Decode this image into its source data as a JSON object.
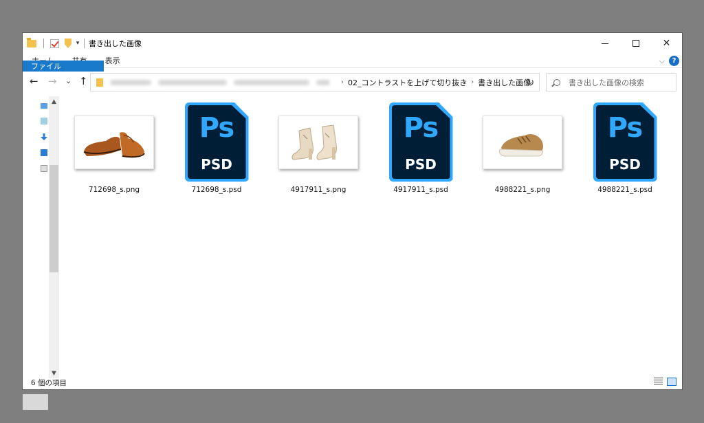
{
  "titlebar": {
    "title": "書き出した画像",
    "quick_access_dropdown": "▾"
  },
  "window_controls": {
    "close": "✕"
  },
  "ribbon": {
    "tabs": [
      "ファイル",
      "ホーム",
      "共有",
      "表示"
    ],
    "collapse_glyph": "⌵",
    "help_glyph": "?"
  },
  "nav": {
    "back": "←",
    "forward": "→",
    "recent": "⌄",
    "up": "↑"
  },
  "address": {
    "crumbs": [
      "02_コントラストを上げて切り抜き",
      "書き出した画像"
    ],
    "separator": "›",
    "dropdown": "⌄",
    "refresh": "↻"
  },
  "search": {
    "placeholder": "書き出した画像の検索"
  },
  "navpane": {
    "scroll_up": "▲",
    "scroll_down": "▼"
  },
  "files": [
    {
      "name": "712698_s.png",
      "type": "png",
      "shoe": "brown-loafers"
    },
    {
      "name": "712698_s.psd",
      "type": "psd"
    },
    {
      "name": "4917911_s.png",
      "type": "png",
      "shoe": "beige-booties"
    },
    {
      "name": "4917911_s.psd",
      "type": "psd"
    },
    {
      "name": "4988221_s.png",
      "type": "png",
      "shoe": "tan-sneaker"
    },
    {
      "name": "4988221_s.psd",
      "type": "psd"
    }
  ],
  "psd_icon": {
    "ps": "Ps",
    "label": "PSD"
  },
  "status": {
    "count": "6 個の項目"
  },
  "colors": {
    "accent": "#1979ca",
    "ps_blue": "#31a8ff",
    "ps_dark": "#001e36"
  }
}
